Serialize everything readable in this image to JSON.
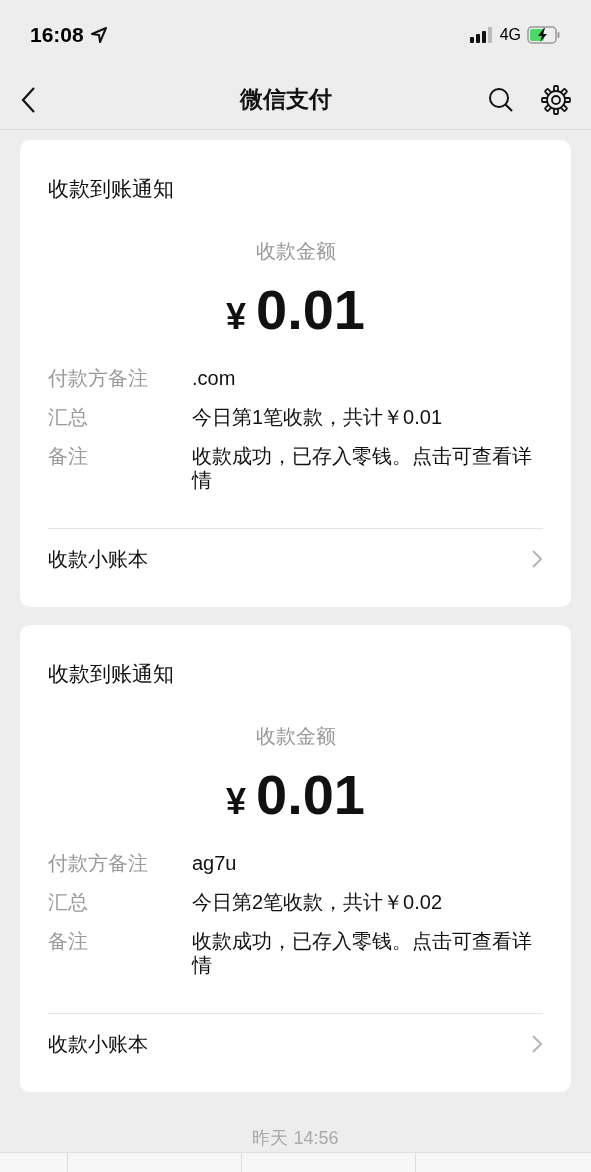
{
  "status_bar": {
    "time": "16:08",
    "network": "4G"
  },
  "nav": {
    "title": "微信支付"
  },
  "messages": [
    {
      "title": "收款到账通知",
      "amount_label": "收款金额",
      "currency": "¥",
      "amount": "0.01",
      "fields": [
        {
          "label": "付款方备注",
          "value": ".com"
        },
        {
          "label": "汇总",
          "value": "今日第1笔收款，共计￥0.01"
        },
        {
          "label": "备注",
          "value": "收款成功，已存入零钱。点击可查看详情"
        }
      ],
      "link": "收款小账本"
    },
    {
      "title": "收款到账通知",
      "amount_label": "收款金额",
      "currency": "¥",
      "amount": "0.01",
      "fields": [
        {
          "label": "付款方备注",
          "value": "ag7u"
        },
        {
          "label": "汇总",
          "value": "今日第2笔收款，共计￥0.02"
        },
        {
          "label": "备注",
          "value": "收款成功，已存入零钱。点击可查看详情"
        }
      ],
      "link": "收款小账本"
    }
  ],
  "timestamp": "昨天 14:56"
}
